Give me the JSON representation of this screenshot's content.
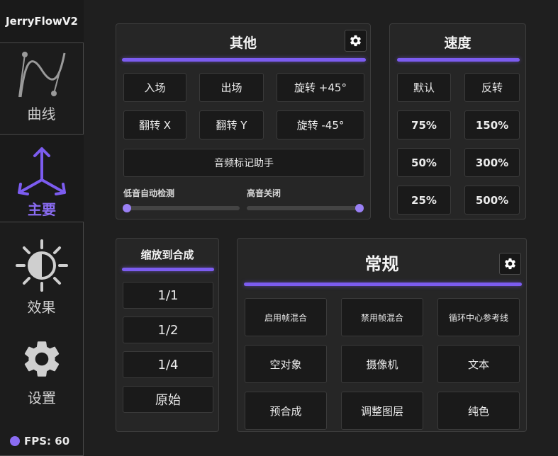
{
  "app": {
    "title": "JerryFlowV2"
  },
  "sidebar": {
    "items": [
      {
        "label": "曲线",
        "icon": "curve-icon"
      },
      {
        "label": "主要",
        "icon": "arrows-icon",
        "active": true
      },
      {
        "label": "效果",
        "icon": "contrast-sun-icon"
      },
      {
        "label": "设置",
        "icon": "gear-icon"
      }
    ],
    "fps_label": "FPS: 60"
  },
  "colors": {
    "accent": "#7c5cf0",
    "background": "#1f1f1f",
    "panel": "#262626"
  },
  "other": {
    "title": "其他",
    "buttons": [
      "入场",
      "出场",
      "旋转 +45°",
      "翻转 X",
      "翻转 Y",
      "旋转 -45°",
      "音频标记助手"
    ],
    "sliders": [
      {
        "label": "低音自动检测",
        "value": 0
      },
      {
        "label": "高音关闭",
        "value": 1
      }
    ]
  },
  "speed": {
    "title": "速度",
    "buttons": [
      "默认",
      "反转",
      "75%",
      "150%",
      "50%",
      "300%",
      "25%",
      "500%"
    ]
  },
  "fit": {
    "title": "缩放到合成",
    "buttons": [
      "1/1",
      "1/2",
      "1/4",
      "原始"
    ]
  },
  "general": {
    "title": "常规",
    "buttons": [
      "启用帧混合",
      "禁用帧混合",
      "循环中心参考线",
      "空对象",
      "摄像机",
      "文本",
      "预合成",
      "调整图层",
      "纯色"
    ]
  }
}
